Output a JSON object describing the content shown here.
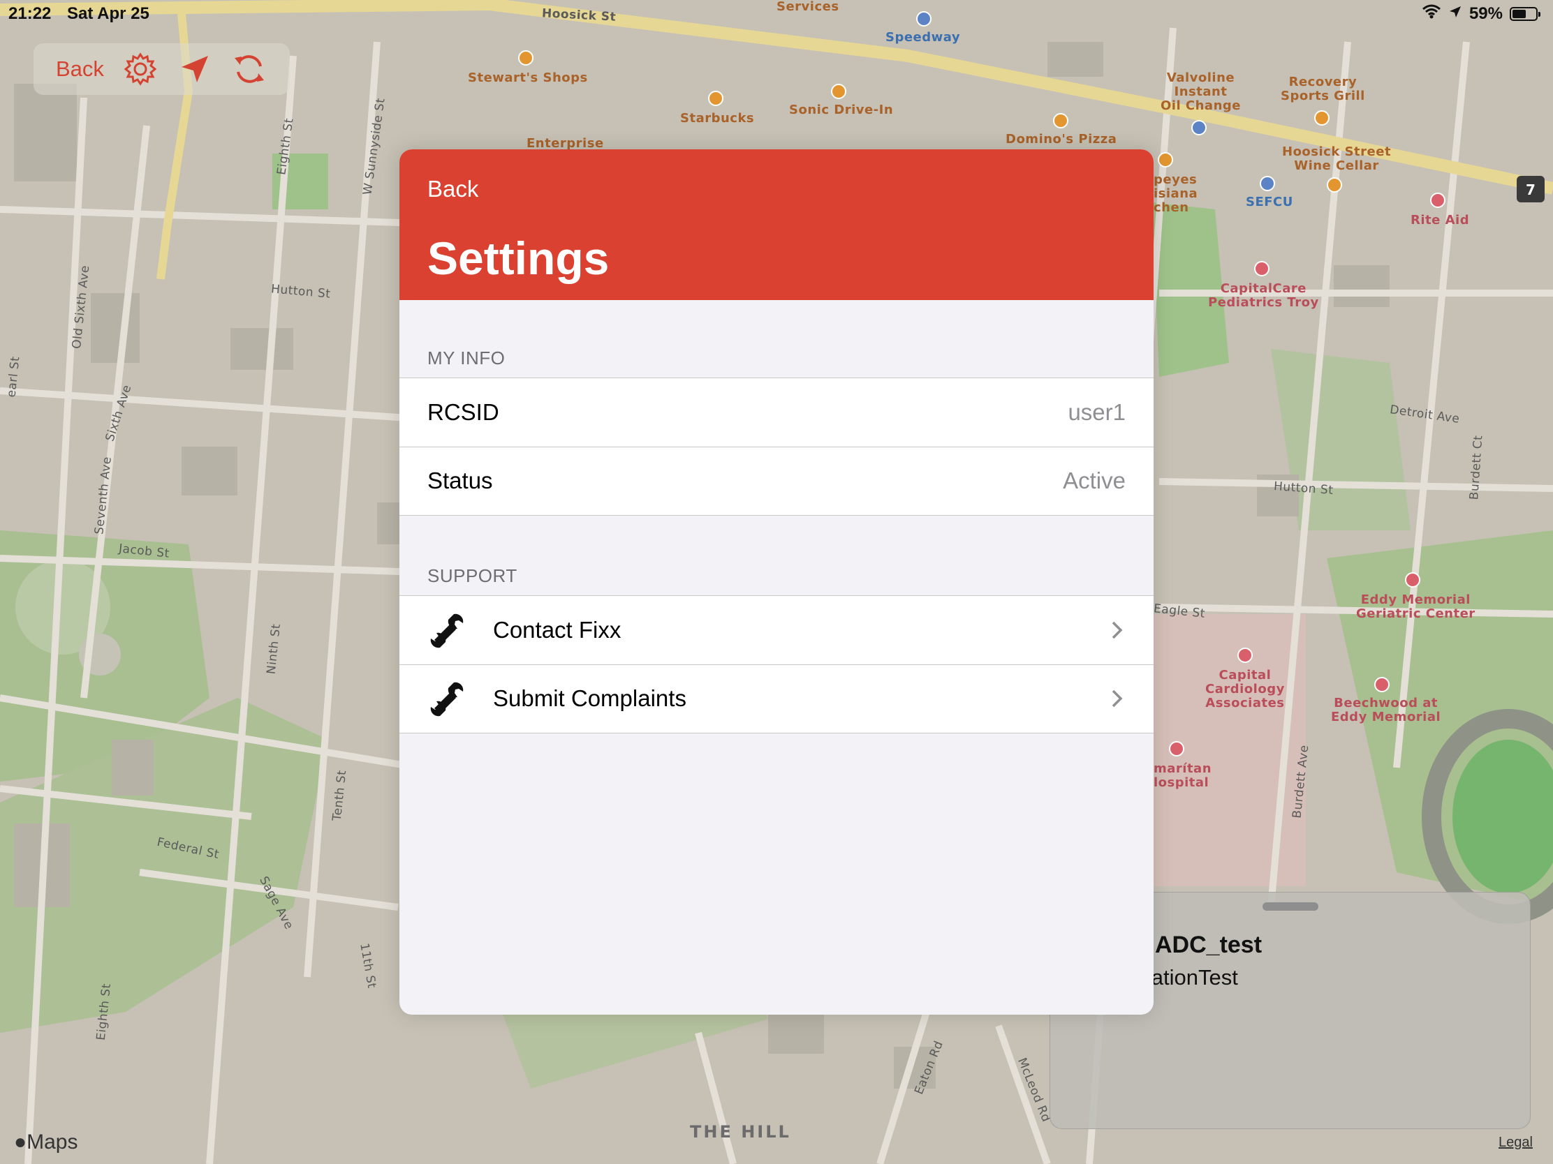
{
  "status_bar": {
    "time": "21:22",
    "date": "Sat Apr 25",
    "battery": "59%",
    "battery_level": 0.59,
    "wifi_icon": "wifi-icon",
    "location_icon": "location-arrow-icon",
    "battery_icon": "battery-icon"
  },
  "toolbar": {
    "back_label": "Back",
    "settings_icon": "gear-icon",
    "locate_icon": "location-arrow-icon",
    "refresh_icon": "refresh-icon"
  },
  "map": {
    "pois": [
      {
        "label": "Services",
        "tone": "orange"
      },
      {
        "label": "Speedway",
        "tone": "blue"
      },
      {
        "label": "Stewart's Shops",
        "tone": "orange"
      },
      {
        "label": "Starbucks",
        "tone": "orange"
      },
      {
        "label": "Sonic Drive-In",
        "tone": "orange"
      },
      {
        "label": "Enterprise",
        "tone": "orange"
      },
      {
        "label": "Domino's Pizza",
        "tone": "orange"
      },
      {
        "label": "Valvoline\nInstant\nOil Change",
        "tone": "orange"
      },
      {
        "label": "Recovery\nSports Grill",
        "tone": "orange"
      },
      {
        "label": "Hoosick Street\nWine Cellar",
        "tone": "orange"
      },
      {
        "label": "peyes\nisiana\nchen",
        "tone": "orange"
      },
      {
        "label": "SEFCU",
        "tone": "blue"
      },
      {
        "label": "Rite Aid",
        "tone": "pink"
      },
      {
        "label": "CapitalCare\nPediatrics Troy",
        "tone": "pink"
      },
      {
        "label": "Eddy Memorial\nGeriatric Center",
        "tone": "pink"
      },
      {
        "label": "Capital\nCardiology\nAssociates",
        "tone": "pink"
      },
      {
        "label": "Beechwood at\nEddy Memorial",
        "tone": "pink"
      },
      {
        "label": "marítan\nlospital",
        "tone": "pink"
      }
    ],
    "streets": [
      "Hoosick St",
      "Hutton St",
      "Eighth St",
      "W Sunnyside St",
      "Old Sixth Ave",
      "Sixth Ave",
      "Seventh Ave",
      "Jacob St",
      "Ninth St",
      "Tenth St",
      "Federal St",
      "Sage Ave",
      "11th St",
      "Eighth St",
      "Detroit Ave",
      "Hutton St",
      "Burdett Ct",
      "Eagle St",
      "Burdett Ave",
      "Eaton Rd",
      "McLeod Rd",
      "THE HILL",
      "earl St"
    ],
    "route_shield": "7",
    "brand": "Maps",
    "legal": "Legal"
  },
  "bottom_sheet": {
    "title": "ADC_test",
    "subtitle": "ocationTest"
  },
  "modal": {
    "back_label": "Back",
    "title": "Settings",
    "sections": [
      {
        "header": "MY INFO",
        "rows": [
          {
            "label": "RCSID",
            "value": "user1"
          },
          {
            "label": "Status",
            "value": "Active"
          }
        ]
      },
      {
        "header": "SUPPORT",
        "rows": [
          {
            "label": "Contact Fixx",
            "icon": "wrench-icon"
          },
          {
            "label": "Submit Complaints",
            "icon": "wrench-icon"
          }
        ]
      }
    ]
  },
  "colors": {
    "accent": "#db4131",
    "toolbar_accent": "#d44332",
    "map_base": "#c6c1b4",
    "park": "#a9c08f",
    "road": "#e2ded5",
    "major_road": "#e7d89a"
  }
}
